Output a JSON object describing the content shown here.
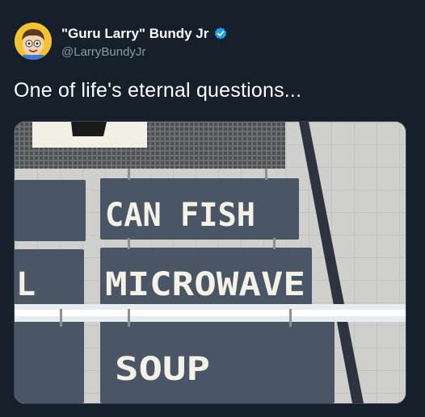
{
  "author": {
    "display_name": "\"Guru Larry\" Bundy Jr",
    "handle": "@LarryBundyJr",
    "verified": true,
    "avatar_icon": "cartoon-avatar-icon",
    "verified_icon": "verified-badge-icon"
  },
  "tweet": {
    "text": "One of life's eternal questions..."
  },
  "media": {
    "sign_lines": [
      "CAN FISH",
      "MICROWAVE",
      "SOUP"
    ],
    "edge_fragment": "L"
  },
  "colors": {
    "background": "#15202b",
    "secondary_text": "#8899a6",
    "verified_blue": "#1da1f2",
    "sign_panel": "#4a5566"
  }
}
